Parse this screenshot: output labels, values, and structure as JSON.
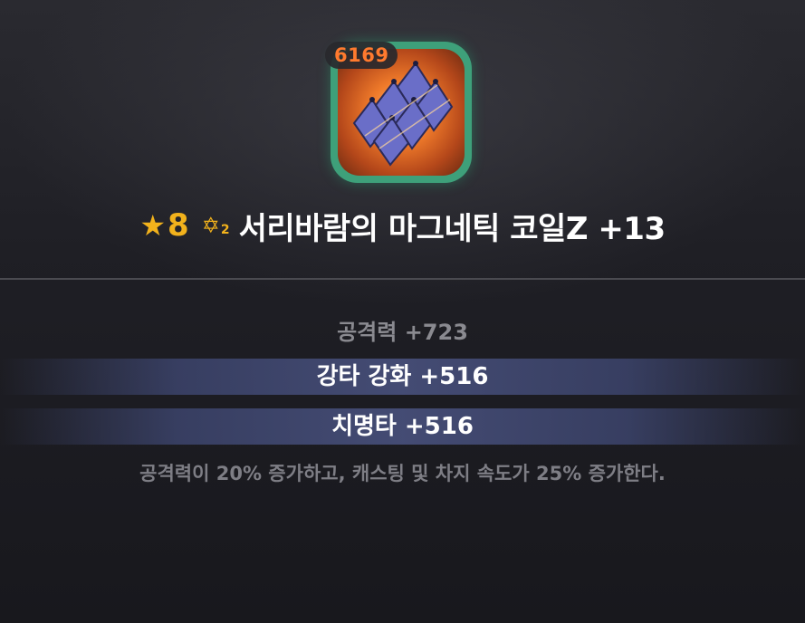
{
  "item": {
    "power": "6169",
    "icon": "magnetic-coil-icon",
    "frame_color": "#3ea07a",
    "star_symbol": "★",
    "star_grade": "8",
    "awaken_symbol": "✡",
    "awaken_level": "2",
    "name": "서리바람의 마그네틱 코일Z +13"
  },
  "stats": {
    "base": "공격력 +723",
    "sub1": "강타 강화 +516",
    "sub2": "치명타 +516",
    "effect": "공격력이 20% 증가하고, 캐스팅 및 차지 속도가 25% 증가한다."
  },
  "colors": {
    "grade_gold": "#f2b21c",
    "power_orange": "#ff7a2e",
    "stat_bar": "#464e78"
  }
}
